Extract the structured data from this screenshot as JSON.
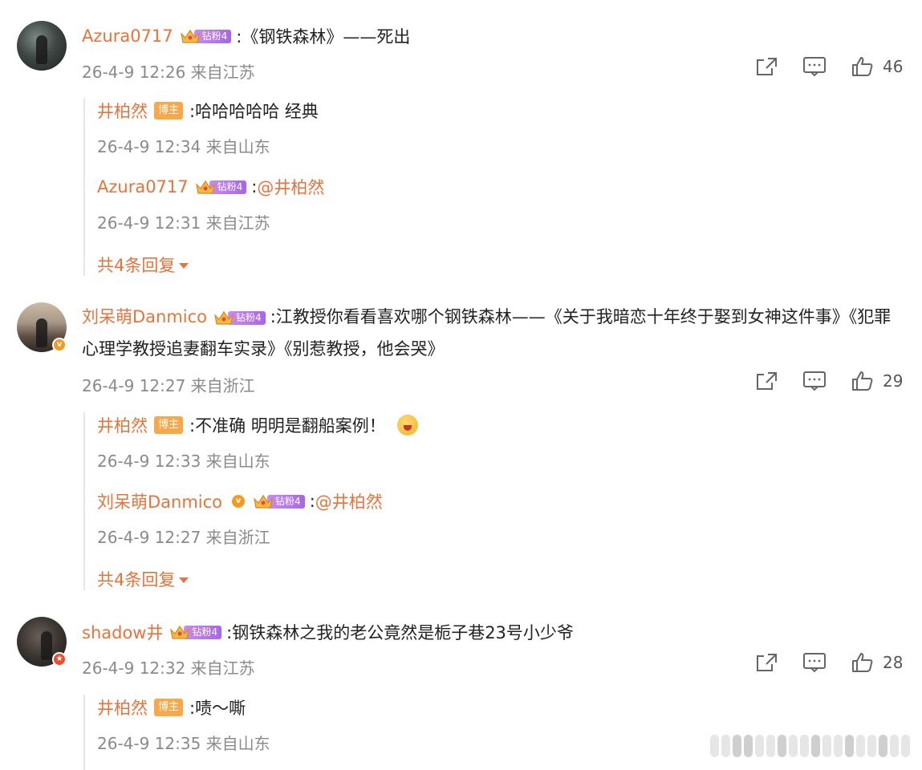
{
  "colors": {
    "username": "#e8733a",
    "meta": "#8a8a8a",
    "fan_badge": "#b678ec",
    "author_tag": "#f7a84a"
  },
  "comments": [
    {
      "username": "Azura0717",
      "fan_badge": "钻粉4",
      "text": ":《钢铁森林》——死出",
      "meta": "26-4-9 12:26 来自江苏",
      "likes": "46",
      "replies": [
        {
          "username": "井柏然",
          "author_tag": "博主",
          "text": ":哈哈哈哈哈 经典",
          "meta": "26-4-9 12:34 来自山东"
        },
        {
          "username": "Azura0717",
          "fan_badge": "钻粉4",
          "prefix": ":",
          "mention": "@井柏然",
          "meta": "26-4-9 12:31 来自江苏"
        }
      ],
      "more_replies": "共4条回复"
    },
    {
      "username": "刘呆萌Danmico",
      "fan_badge": "钻粉4",
      "text": ":江教授你看看喜欢哪个钢铁森林——《关于我暗恋十年终于娶到女神这件事》《犯罪心理学教授追妻翻车实录》《别惹教授，他会哭》",
      "meta": "26-4-9 12:27 来自浙江",
      "likes": "29",
      "replies": [
        {
          "username": "井柏然",
          "author_tag": "博主",
          "text": ":不准确 明明是翻船案例！",
          "meta": "26-4-9 12:33 来自山东"
        },
        {
          "username": "刘呆萌Danmico",
          "fan_badge": "钻粉4",
          "prefix": ":",
          "mention": "@井柏然",
          "meta": "26-4-9 12:27 来自浙江"
        }
      ],
      "more_replies": "共4条回复"
    },
    {
      "username": "shadow井",
      "fan_badge": "钻粉4",
      "text": ":钢铁森林之我的老公竟然是栀子巷23号小少爷",
      "meta": "26-4-9 12:32 来自江苏",
      "likes": "28",
      "replies": [
        {
          "username": "井柏然",
          "author_tag": "博主",
          "text": ":啧～嘶",
          "meta": "26-4-9 12:35 来自山东"
        }
      ]
    }
  ]
}
